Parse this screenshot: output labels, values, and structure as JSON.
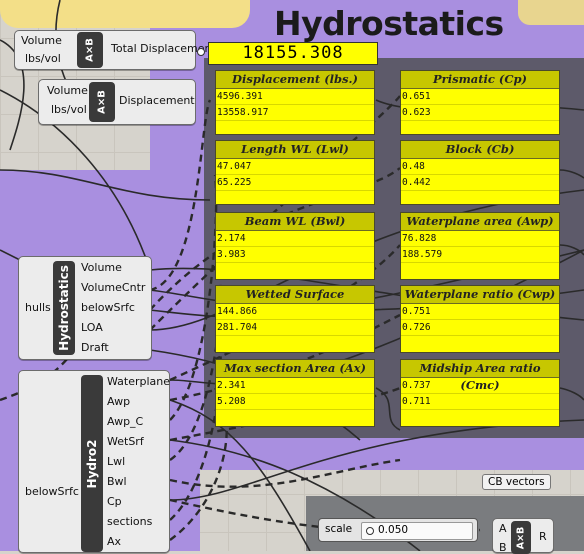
{
  "title": "Hydrostatics",
  "total_display": "18155.308",
  "comp1": {
    "inputs": [
      "Volume",
      "lbs/vol"
    ],
    "op": "A×B",
    "output": "Total Displacement"
  },
  "comp2": {
    "inputs": [
      "Volume",
      "lbs/vol"
    ],
    "op": "A×B",
    "output": "Displacement"
  },
  "hydrostatics_comp": {
    "input": "hulls",
    "name": "Hydrostatics",
    "outputs": [
      "Volume",
      "VolumeCntr",
      "belowSrfc",
      "LOA",
      "Draft"
    ]
  },
  "hydro2_comp": {
    "input": "belowSrfc",
    "name": "Hydro2",
    "outputs": [
      "Waterplane",
      "Awp",
      "Awp_C",
      "WetSrf",
      "Lwl",
      "Bwl",
      "Cp",
      "sections",
      "Ax"
    ]
  },
  "panels_left": [
    {
      "title": "Displacement (lbs.)",
      "values": [
        "4596.391",
        "13558.917"
      ]
    },
    {
      "title": "Length WL (Lwl)",
      "values": [
        "47.047",
        "65.225"
      ]
    },
    {
      "title": "Beam WL (Bwl)",
      "values": [
        "2.174",
        "3.983"
      ]
    },
    {
      "title": "Wetted Surface",
      "values": [
        "144.866",
        "281.704"
      ]
    },
    {
      "title": "Max section Area (Ax)",
      "values": [
        "2.341",
        "5.208"
      ]
    }
  ],
  "panels_right": [
    {
      "title": "Prismatic (Cp)",
      "values": [
        "0.651",
        "0.623"
      ]
    },
    {
      "title": "Block (Cb)",
      "values": [
        "0.48",
        "0.442"
      ]
    },
    {
      "title": "Waterplane area (Awp)",
      "values": [
        "76.828",
        "188.579"
      ]
    },
    {
      "title": "Waterplane ratio (Cwp)",
      "values": [
        "0.751",
        "0.726"
      ]
    },
    {
      "title": "Midship Area ratio (Cmc)",
      "values": [
        "0.737",
        "0.711"
      ]
    }
  ],
  "cb_vectors": {
    "label": "CB vectors"
  },
  "slider": {
    "name": "scale",
    "value": "0.050"
  },
  "comp3": {
    "inputs": [
      "A",
      "B"
    ],
    "op": "A×B",
    "output": "R"
  }
}
